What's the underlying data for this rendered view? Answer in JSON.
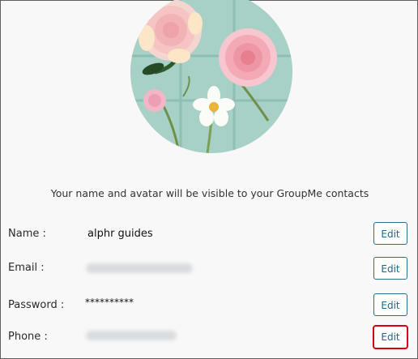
{
  "profile": {
    "avatar_alt": "flowers",
    "tagline": "Your name and avatar will be visible to your GroupMe contacts"
  },
  "fields": [
    {
      "label": "Name :",
      "value": "alphr guides",
      "value_hidden": false,
      "edit_label": "Edit",
      "highlighted": false
    },
    {
      "label": "Email :",
      "value": "",
      "value_hidden": true,
      "edit_label": "Edit",
      "highlighted": false
    },
    {
      "label": "Password :",
      "value": "**********",
      "value_hidden": false,
      "edit_label": "Edit",
      "highlighted": false
    },
    {
      "label": "Phone :",
      "value": "",
      "value_hidden": true,
      "edit_label": "Edit",
      "highlighted": true
    }
  ],
  "colors": {
    "button_border": "#2e6f8e",
    "button_text": "#22658a",
    "highlight": "#d7000f",
    "avatar_bg": "#a7d1c6"
  }
}
